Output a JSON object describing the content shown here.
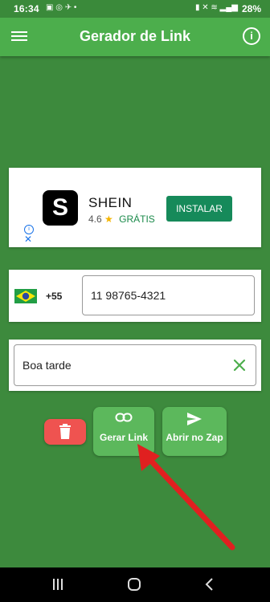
{
  "status_bar": {
    "time": "16:34",
    "battery": "28%"
  },
  "app_bar": {
    "title": "Gerador de Link"
  },
  "ad": {
    "brand_letter": "S",
    "name": "SHEIN",
    "rating": "4.6",
    "price": "GRÁTIS",
    "install_label": "INSTALAR"
  },
  "phone": {
    "country_code": "+55",
    "number": "11 98765-4321"
  },
  "message": {
    "text": "Boa tarde"
  },
  "buttons": {
    "generate_label": "Gerar Link",
    "open_label": "Abrir no Zap"
  },
  "colors": {
    "background": "#3d8a3d",
    "appbar": "#4cae4c",
    "button": "#5cb85c",
    "delete": "#ef5350",
    "arrow": "#e02020",
    "ad_install": "#168a5a"
  }
}
